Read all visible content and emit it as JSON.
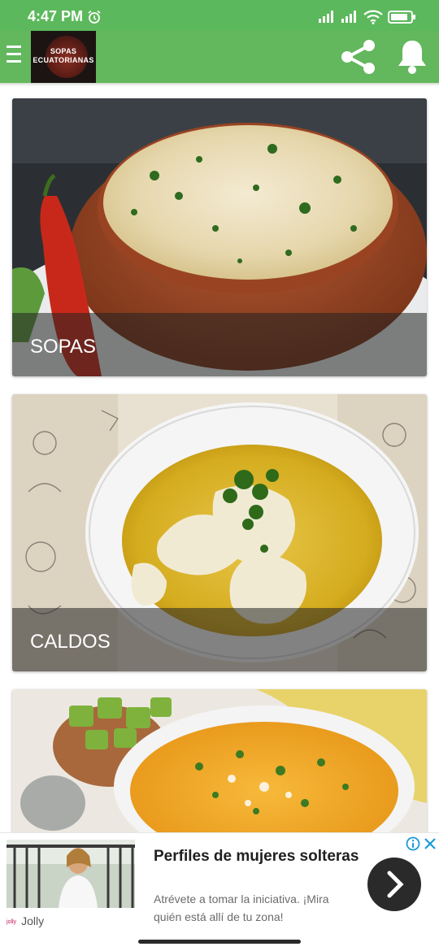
{
  "status_bar": {
    "time": "4:47 PM",
    "icons": [
      "alarm-icon",
      "signal-icon",
      "signal-icon",
      "wifi-icon",
      "battery-icon"
    ]
  },
  "app_bar": {
    "background_color": "#63b75d",
    "logo_text": "SOPAS ECUATORIANAS",
    "icons": [
      "menu-icon",
      "share-icon",
      "bell-icon"
    ]
  },
  "categories": [
    {
      "label": "SOPAS"
    },
    {
      "label": "CALDOS"
    },
    {
      "label": ""
    }
  ],
  "ad": {
    "title": "Perfiles de mujeres solteras",
    "text": "Atrévete a tomar la iniciativa. ¡Mira quién está allí de tu zona!",
    "brand": "Jolly",
    "icons": [
      "info-icon",
      "close-icon",
      "arrow-right-icon"
    ]
  }
}
